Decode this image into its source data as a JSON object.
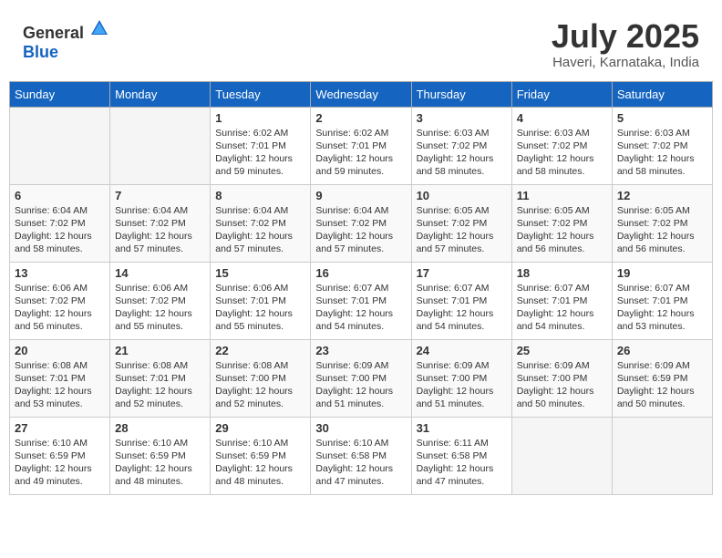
{
  "header": {
    "logo_general": "General",
    "logo_blue": "Blue",
    "month_year": "July 2025",
    "location": "Haveri, Karnataka, India"
  },
  "days_of_week": [
    "Sunday",
    "Monday",
    "Tuesday",
    "Wednesday",
    "Thursday",
    "Friday",
    "Saturday"
  ],
  "weeks": [
    [
      {
        "day": "",
        "empty": true
      },
      {
        "day": "",
        "empty": true
      },
      {
        "day": "1",
        "sunrise": "6:02 AM",
        "sunset": "7:01 PM",
        "daylight": "12 hours and 59 minutes."
      },
      {
        "day": "2",
        "sunrise": "6:02 AM",
        "sunset": "7:01 PM",
        "daylight": "12 hours and 59 minutes."
      },
      {
        "day": "3",
        "sunrise": "6:03 AM",
        "sunset": "7:02 PM",
        "daylight": "12 hours and 58 minutes."
      },
      {
        "day": "4",
        "sunrise": "6:03 AM",
        "sunset": "7:02 PM",
        "daylight": "12 hours and 58 minutes."
      },
      {
        "day": "5",
        "sunrise": "6:03 AM",
        "sunset": "7:02 PM",
        "daylight": "12 hours and 58 minutes."
      }
    ],
    [
      {
        "day": "6",
        "sunrise": "6:04 AM",
        "sunset": "7:02 PM",
        "daylight": "12 hours and 58 minutes."
      },
      {
        "day": "7",
        "sunrise": "6:04 AM",
        "sunset": "7:02 PM",
        "daylight": "12 hours and 57 minutes."
      },
      {
        "day": "8",
        "sunrise": "6:04 AM",
        "sunset": "7:02 PM",
        "daylight": "12 hours and 57 minutes."
      },
      {
        "day": "9",
        "sunrise": "6:04 AM",
        "sunset": "7:02 PM",
        "daylight": "12 hours and 57 minutes."
      },
      {
        "day": "10",
        "sunrise": "6:05 AM",
        "sunset": "7:02 PM",
        "daylight": "12 hours and 57 minutes."
      },
      {
        "day": "11",
        "sunrise": "6:05 AM",
        "sunset": "7:02 PM",
        "daylight": "12 hours and 56 minutes."
      },
      {
        "day": "12",
        "sunrise": "6:05 AM",
        "sunset": "7:02 PM",
        "daylight": "12 hours and 56 minutes."
      }
    ],
    [
      {
        "day": "13",
        "sunrise": "6:06 AM",
        "sunset": "7:02 PM",
        "daylight": "12 hours and 56 minutes."
      },
      {
        "day": "14",
        "sunrise": "6:06 AM",
        "sunset": "7:02 PM",
        "daylight": "12 hours and 55 minutes."
      },
      {
        "day": "15",
        "sunrise": "6:06 AM",
        "sunset": "7:01 PM",
        "daylight": "12 hours and 55 minutes."
      },
      {
        "day": "16",
        "sunrise": "6:07 AM",
        "sunset": "7:01 PM",
        "daylight": "12 hours and 54 minutes."
      },
      {
        "day": "17",
        "sunrise": "6:07 AM",
        "sunset": "7:01 PM",
        "daylight": "12 hours and 54 minutes."
      },
      {
        "day": "18",
        "sunrise": "6:07 AM",
        "sunset": "7:01 PM",
        "daylight": "12 hours and 54 minutes."
      },
      {
        "day": "19",
        "sunrise": "6:07 AM",
        "sunset": "7:01 PM",
        "daylight": "12 hours and 53 minutes."
      }
    ],
    [
      {
        "day": "20",
        "sunrise": "6:08 AM",
        "sunset": "7:01 PM",
        "daylight": "12 hours and 53 minutes."
      },
      {
        "day": "21",
        "sunrise": "6:08 AM",
        "sunset": "7:01 PM",
        "daylight": "12 hours and 52 minutes."
      },
      {
        "day": "22",
        "sunrise": "6:08 AM",
        "sunset": "7:00 PM",
        "daylight": "12 hours and 52 minutes."
      },
      {
        "day": "23",
        "sunrise": "6:09 AM",
        "sunset": "7:00 PM",
        "daylight": "12 hours and 51 minutes."
      },
      {
        "day": "24",
        "sunrise": "6:09 AM",
        "sunset": "7:00 PM",
        "daylight": "12 hours and 51 minutes."
      },
      {
        "day": "25",
        "sunrise": "6:09 AM",
        "sunset": "7:00 PM",
        "daylight": "12 hours and 50 minutes."
      },
      {
        "day": "26",
        "sunrise": "6:09 AM",
        "sunset": "6:59 PM",
        "daylight": "12 hours and 50 minutes."
      }
    ],
    [
      {
        "day": "27",
        "sunrise": "6:10 AM",
        "sunset": "6:59 PM",
        "daylight": "12 hours and 49 minutes."
      },
      {
        "day": "28",
        "sunrise": "6:10 AM",
        "sunset": "6:59 PM",
        "daylight": "12 hours and 48 minutes."
      },
      {
        "day": "29",
        "sunrise": "6:10 AM",
        "sunset": "6:59 PM",
        "daylight": "12 hours and 48 minutes."
      },
      {
        "day": "30",
        "sunrise": "6:10 AM",
        "sunset": "6:58 PM",
        "daylight": "12 hours and 47 minutes."
      },
      {
        "day": "31",
        "sunrise": "6:11 AM",
        "sunset": "6:58 PM",
        "daylight": "12 hours and 47 minutes."
      },
      {
        "day": "",
        "empty": true
      },
      {
        "day": "",
        "empty": true
      }
    ]
  ],
  "labels": {
    "sunrise": "Sunrise:",
    "sunset": "Sunset:",
    "daylight": "Daylight:"
  }
}
